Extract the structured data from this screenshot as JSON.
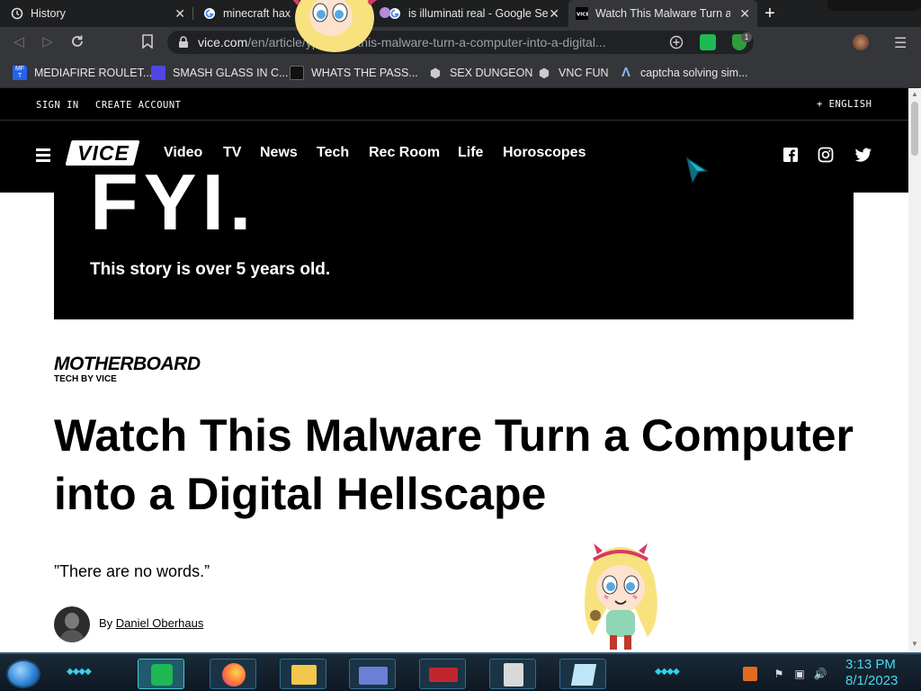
{
  "browser": {
    "tabs": [
      {
        "title": "History",
        "icon": "history-icon",
        "active": false
      },
      {
        "title": "minecraft hax",
        "icon": "google-icon",
        "active": false
      },
      {
        "title": "is illuminati real - Google Se",
        "icon": "google-icon",
        "active": false
      },
      {
        "title": "Watch This Malware Turn a C",
        "icon": "vice-icon",
        "active": true
      }
    ],
    "new_tab": "+",
    "url_host": "vice.com",
    "url_path": "/en/article/yp...atch-this-malware-turn-a-computer-into-a-digital...",
    "bookmarks": [
      {
        "label": "MEDIAFIRE ROULET...",
        "icon": "mediafire-icon",
        "color": "#2563eb"
      },
      {
        "label": "SMASH GLASS IN C...",
        "icon": "smash-icon",
        "color": "#4f46e5"
      },
      {
        "label": "WHATS THE PASS...",
        "icon": "password-icon",
        "color": "#111111"
      },
      {
        "label": "SEX DUNGEON",
        "icon": "dungeon-icon",
        "color": "#bbbbbb"
      },
      {
        "label": "VNC FUN",
        "icon": "vnc-icon",
        "color": "#bbbbbb"
      },
      {
        "label": "captcha solving sim...",
        "icon": "captcha-icon",
        "color": "#8ab4f8"
      }
    ],
    "extension_badge": "1"
  },
  "site": {
    "topbar": {
      "sign_in": "SIGN IN",
      "create_account": "CREATE ACCOUNT",
      "language": "+ ENGLISH"
    },
    "logo": "VICE",
    "nav": [
      "Video",
      "TV",
      "News",
      "Tech",
      "Rec Room",
      "Life",
      "Horoscopes"
    ],
    "social": [
      "facebook-icon",
      "instagram-icon",
      "twitter-icon"
    ]
  },
  "article": {
    "fyi_big": "FYI.",
    "fyi_notice": "This story is over 5 years old.",
    "brand": "MOTHERBOARD",
    "brand_sub": "TECH BY VICE",
    "headline": "Watch This Malware Turn a Computer into a Digital Hellscape",
    "dek": "”There are no words.”",
    "by": "By ",
    "author": "Daniel Oberhaus"
  },
  "taskbar": {
    "time": "3:13 PM",
    "date": "8/1/2023",
    "apps": [
      "spotify-icon",
      "firefox-icon",
      "file-explorer-icon",
      "id-card-icon",
      "game-icon",
      "server-icon",
      "notepad-icon"
    ]
  },
  "colors": {
    "accent_cyan": "#34d3e8",
    "chrome_dark": "#35363a",
    "vice_black": "#000000"
  }
}
